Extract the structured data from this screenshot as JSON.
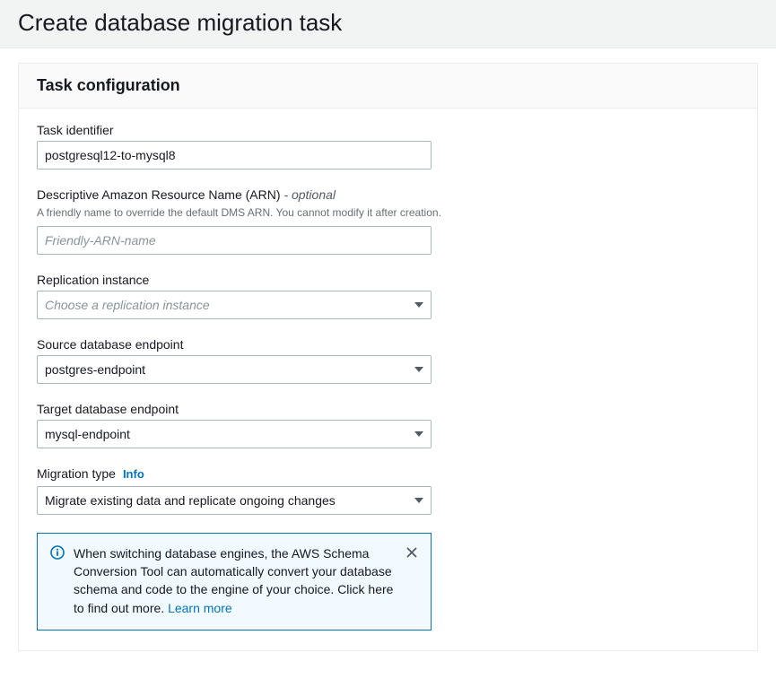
{
  "header": {
    "title": "Create database migration task"
  },
  "panel": {
    "title": "Task configuration"
  },
  "fields": {
    "task_id": {
      "label": "Task identifier",
      "value": "postgresql12-to-mysql8"
    },
    "arn": {
      "label": "Descriptive Amazon Resource Name (ARN)",
      "optional": " - optional",
      "help": "A friendly name to override the default DMS ARN. You cannot modify it after creation.",
      "placeholder": "Friendly-ARN-name",
      "value": ""
    },
    "replication": {
      "label": "Replication instance",
      "placeholder": "Choose a replication instance",
      "value": ""
    },
    "source": {
      "label": "Source database endpoint",
      "value": "postgres-endpoint"
    },
    "target": {
      "label": "Target database endpoint",
      "value": "mysql-endpoint"
    },
    "migration_type": {
      "label": "Migration type",
      "info": "Info",
      "value": "Migrate existing data and replicate ongoing changes"
    }
  },
  "info_box": {
    "text": "When switching database engines, the AWS Schema Conversion Tool can automatically convert your database schema and code to the engine of your choice. Click here to find out more. ",
    "learn_more": "Learn more"
  }
}
